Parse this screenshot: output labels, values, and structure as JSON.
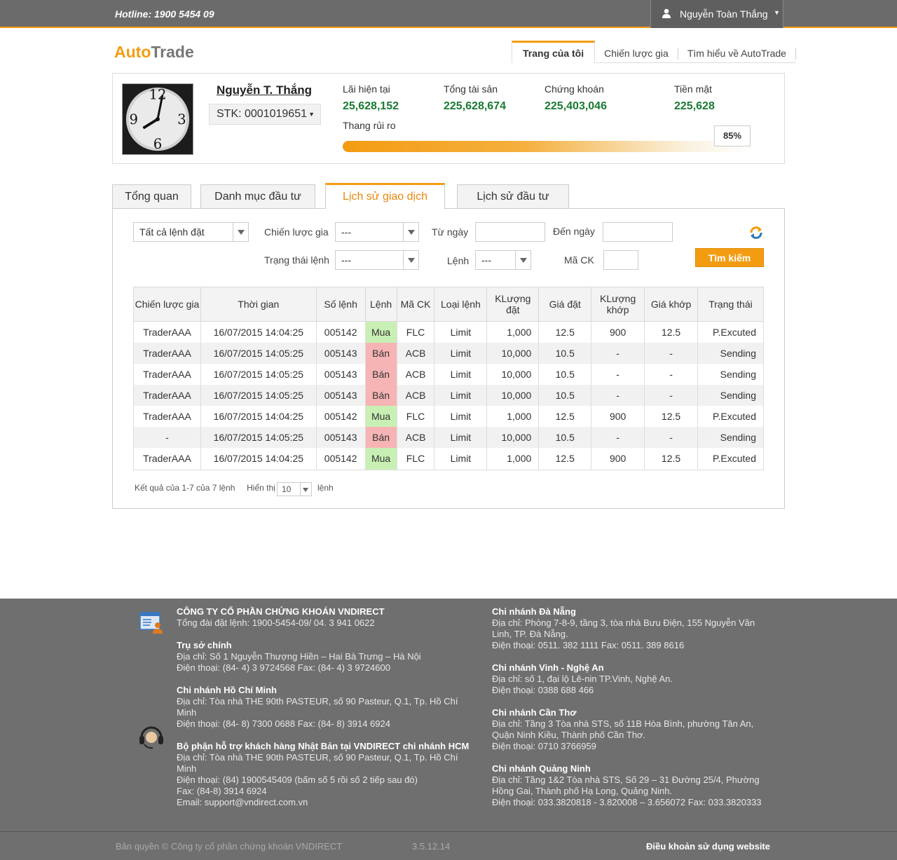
{
  "topbar": {
    "hotline": "Hotline: 1900 5454 09",
    "user_name": "Nguyễn Toàn Thắng"
  },
  "header": {
    "logo_a": "Auto",
    "logo_b": "Trade",
    "nav": [
      "Trang của tôi",
      "Chiến lược gia",
      "Tìm hiểu về AutoTrade"
    ]
  },
  "profile": {
    "name": "Nguyễn T. Thắng",
    "account": "STK: 0001019651",
    "stats": [
      {
        "label": "Lãi hiện tại",
        "value": "25,628,152"
      },
      {
        "label": "Tổng tài sản",
        "value": "225,628,674"
      },
      {
        "label": "Chứng khoán",
        "value": "225,403,046"
      },
      {
        "label": "Tiền mặt",
        "value": "225,628"
      }
    ],
    "risk_label": "Thang rủi ro",
    "risk_percent": "85%"
  },
  "tabs": [
    "Tổng quan",
    "Danh mục đầu tư",
    "Lịch sử giao dịch",
    "Lịch sử đầu tư"
  ],
  "filters": {
    "order_scope": "Tất cả lệnh đặt",
    "strategist_label": "Chiến lược gia",
    "strategist_value": "---",
    "from_label": "Từ ngày",
    "to_label": "Đến ngày",
    "status_label": "Trạng thái lệnh",
    "status_value": "---",
    "side_label": "Lệnh",
    "side_value": "---",
    "symbol_label": "Mã CK",
    "search_button": "Tìm kiếm"
  },
  "table": {
    "headers": [
      "Chiến lược gia",
      "Thời gian",
      "Số lệnh",
      "Lệnh",
      "Mã CK",
      "Loại lệnh",
      "KLượng đặt",
      "Giá đặt",
      "KLượng khớp",
      "Giá khớp",
      "Trạng thái"
    ],
    "rows": [
      [
        "TraderAAA",
        "16/07/2015  14:04:25",
        "005142",
        "Mua",
        "FLC",
        "Limit",
        "1,000",
        "12.5",
        "900",
        "12.5",
        "P.Excuted"
      ],
      [
        "TraderAAA",
        "16/07/2015  14:05:25",
        "005143",
        "Bán",
        "ACB",
        "Limit",
        "10,000",
        "10.5",
        "-",
        "-",
        "Sending"
      ],
      [
        "TraderAAA",
        "16/07/2015  14:05:25",
        "005143",
        "Bán",
        "ACB",
        "Limit",
        "10,000",
        "10.5",
        "-",
        "-",
        "Sending"
      ],
      [
        "TraderAAA",
        "16/07/2015  14:05:25",
        "005143",
        "Bán",
        "ACB",
        "Limit",
        "10,000",
        "10.5",
        "-",
        "-",
        "Sending"
      ],
      [
        "TraderAAA",
        "16/07/2015  14:04:25",
        "005142",
        "Mua",
        "FLC",
        "Limit",
        "1,000",
        "12.5",
        "900",
        "12.5",
        "P.Excuted"
      ],
      [
        "-",
        "16/07/2015  14:05:25",
        "005143",
        "Bán",
        "ACB",
        "Limit",
        "10,000",
        "10.5",
        "-",
        "-",
        "Sending"
      ],
      [
        "TraderAAA",
        "16/07/2015  14:04:25",
        "005142",
        "Mua",
        "FLC",
        "Limit",
        "1,000",
        "12.5",
        "900",
        "12.5",
        "P.Excuted"
      ]
    ]
  },
  "pager": {
    "result": "Kết quả của 1-7 của 7 lệnh",
    "show_label": "Hiển thị",
    "page_size": "10",
    "unit": "lệnh"
  },
  "footer": {
    "left": [
      {
        "title": "CÔNG TY CỔ PHẦN CHỨNG KHOÁN VNDIRECT",
        "lines": [
          "Tổng đài đặt lệnh: 1900-5454-09/ 04. 3 941 0622"
        ]
      },
      {
        "title": "Trụ sở chính",
        "lines": [
          "Địa chỉ: Số 1 Nguyễn Thượng Hiền – Hai Bà Trưng – Hà Nội",
          "Điện thoại: (84- 4) 3 9724568     Fax:  (84- 4) 3 9724600"
        ]
      },
      {
        "title": "Chi nhánh Hồ Chí Minh",
        "lines": [
          "Địa chỉ: Tòa nhà THE 90th PASTEUR, số 90 Pasteur, Q.1, Tp. Hồ Chí Minh",
          "Điện thoại:  (84- 8) 7300 0688  Fax: (84- 8) 3914 6924"
        ]
      },
      {
        "title": "Bộ phận hỗ trợ khách hàng Nhật Bản tại VNDIRECT chi nhánh HCM",
        "lines": [
          "Địa chỉ: Tòa nhà THE 90th PASTEUR, số 90 Pasteur, Q.1, Tp. Hồ Chí Minh",
          "Điện thoại: (84) 1900545409 (bấm số 5 rồi số 2 tiếp sau đó)",
          "Fax: (84-8) 3914 6924",
          "Email: support@vndirect.com.vn"
        ]
      }
    ],
    "right": [
      {
        "title": "Chi nhánh Đà Nẵng",
        "lines": [
          "Địa chỉ: Phòng 7-8-9, tầng 3, tòa nhà Bưu Điện, 155 Nguyễn Văn Linh, TP. Đà Nẵng.",
          "Điện thoại: 0511. 382 1111    Fax: 0511. 389 8616"
        ]
      },
      {
        "title": "Chi nhánh Vinh - Nghệ An",
        "lines": [
          "Địa chỉ: số 1, đại lộ Lê-nin TP.Vinh, Nghệ An.",
          "Điện thoại: 0388 688 466"
        ]
      },
      {
        "title": "Chi nhánh Cần Thơ",
        "lines": [
          " Địa chỉ: Tầng 3 Tòa nhà STS, số 11B Hòa Bình, phường Tân An, Quận Ninh Kiều, Thành phố Cần Thơ.",
          "Điện thoại:  0710 3766959"
        ]
      },
      {
        "title": "Chi nhánh Quảng Ninh",
        "lines": [
          " Địa chỉ: Tầng 1&2 Tòa nhà STS, Số 29 – 31 Đường 25/4, Phường Hồng Gai, Thành phố Hạ Long, Quảng Ninh.",
          "Điện thoại:   033.3820818 - 3.820008 – 3.656072      Fax: 033.3820333"
        ]
      }
    ],
    "copyright": "Bản quyền © Công ty cổ phần chứng khoán VNDIRECT",
    "version": "3.5.12.14",
    "terms": "Điều khoản sử dụng website"
  }
}
